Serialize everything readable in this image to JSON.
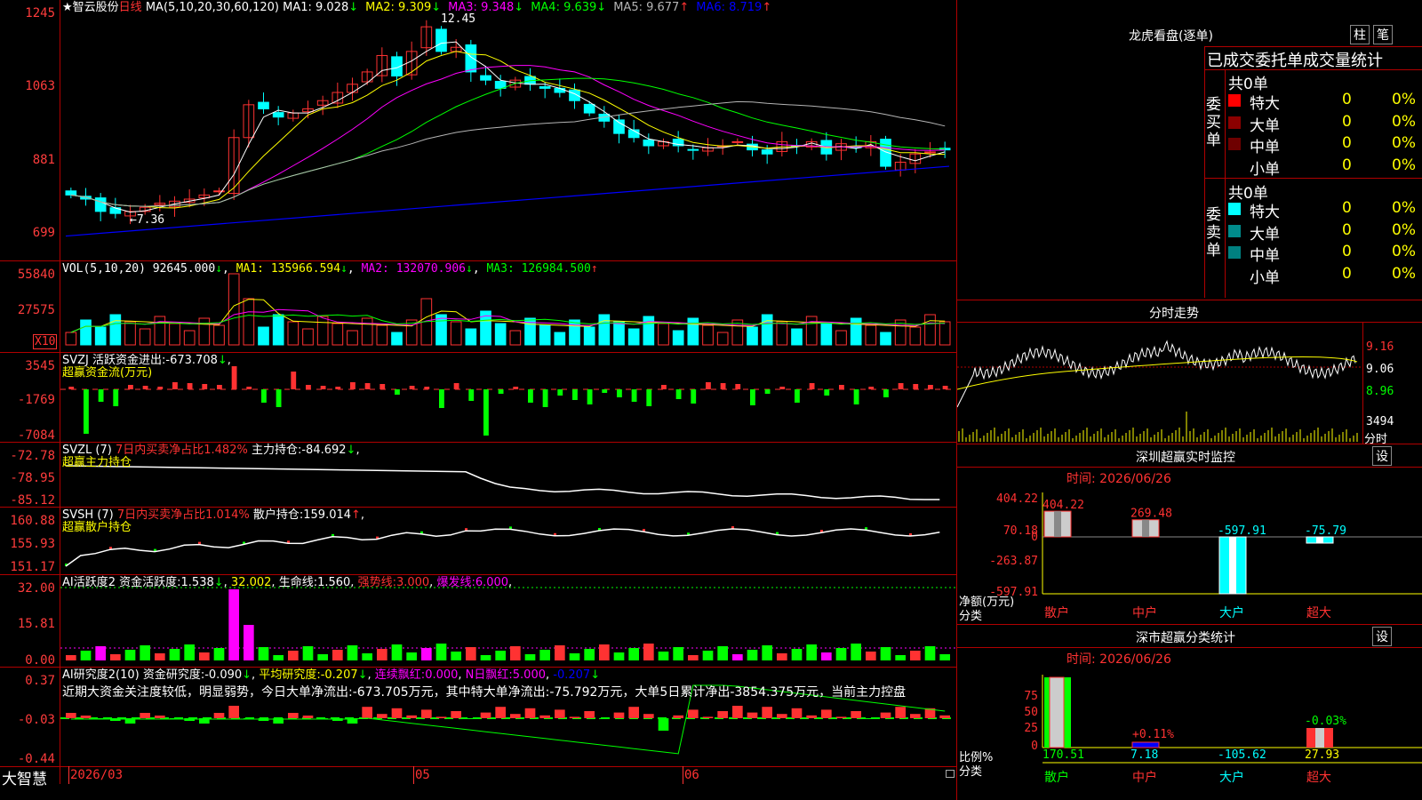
{
  "colors": {
    "up": "#ff3232",
    "down": "#00ffff",
    "frame": "#b00000",
    "green": "#00ff00",
    "magenta": "#ff00ff",
    "yellow": "#ffff00"
  },
  "price": {
    "star_icon": "★",
    "stock_name": "智云股份",
    "period": "日线",
    "ma_label": "MA(5,10,20,30,60,120)",
    "ma_values": [
      {
        "label": "MA1:",
        "value": "9.028",
        "arrow": "↓",
        "color": "#ffffff"
      },
      {
        "label": "MA2:",
        "value": "9.309",
        "arrow": "↓",
        "color": "#ffff00"
      },
      {
        "label": "MA3:",
        "value": "9.348",
        "arrow": "↓",
        "color": "#ff00ff"
      },
      {
        "label": "MA4:",
        "value": "9.639",
        "arrow": "↓",
        "color": "#00ff00"
      },
      {
        "label": "MA5:",
        "value": "9.677",
        "arrow": "↑",
        "color": "#b4b4b4"
      },
      {
        "label": "MA6:",
        "value": "8.719",
        "arrow": "↑",
        "color": "#0000ff"
      }
    ],
    "y_labels": [
      "1245",
      "1063",
      "881",
      "699"
    ],
    "high_label": "12.45",
    "low_label": "←7.36"
  },
  "vol": {
    "title": "VOL(5,10,20)",
    "value": "92645.000",
    "arrow": "↓",
    "ma1": "MA1: 135966.594",
    "ma2": "MA2: 132070.906",
    "ma3": "MA3: 126984.500",
    "y_labels": [
      "55840",
      "27575"
    ],
    "unit": "X10"
  },
  "svzj": {
    "title": "SVZJ",
    "label": "活跃资金进出:",
    "value": "-673.708",
    "arrow": "↓",
    "subtitle": "超赢资金流(万元)",
    "y_labels": [
      "3545",
      "-1769",
      "-7084"
    ]
  },
  "svzl": {
    "title": "SVZL (7)",
    "label2": "7日内买卖净占比1.482%",
    "label3": "主力持仓:",
    "value": "-84.692",
    "subtitle": "超赢主力持仓",
    "y_labels": [
      "-72.78",
      "-78.95",
      "-85.12"
    ]
  },
  "svsh": {
    "title": "SVSH (7)",
    "label2": "7日内买卖净占比1.014%",
    "label3": "散户持仓:",
    "value": "159.014",
    "subtitle": "超赢散户持仓",
    "y_labels": [
      "160.88",
      "155.93",
      "151.17"
    ]
  },
  "ai1": {
    "title": "AI活跃度2",
    "l1": "资金活跃度:",
    "v1": "1.538",
    "v2": "32.002",
    "l3": "生命线:",
    "v3": "1.560",
    "l4": "强势线:",
    "v4": "3.000",
    "l5": "爆发线:",
    "v5": "6.000",
    "y_labels": [
      "32.00",
      "15.81",
      "0.00"
    ]
  },
  "ai2": {
    "title": "AI研究度2(10)",
    "l1": "资金研究度:",
    "v1": "-0.090",
    "l2": "平均研究度:",
    "v2": "-0.207",
    "l3": "连续飘红:",
    "v3": "0.000",
    "l4": "N日飘红:",
    "v4": "5.000",
    "v5": "-0.207",
    "comment": "近期大资金关注度较低，明显弱势，今日大单净流出:-673.705万元，其中特大单净流出:-75.792万元，大单5日累计净出-3854.375万元，当前主力控盘",
    "y_labels": [
      "0.37",
      "-0.03",
      "-0.44"
    ]
  },
  "xaxis": {
    "brand": "大智慧",
    "labels": [
      "2026/03",
      "05",
      "06"
    ]
  },
  "lhb": {
    "title": "龙虎看盘(逐单)",
    "btn1": "柱",
    "btn2": "笔",
    "tabs": [
      "已成交",
      "委托单",
      "成交量统计"
    ],
    "buy": {
      "side": "委买单",
      "total": "共0单",
      "rows": [
        {
          "name": "特大",
          "count": "0",
          "pct": "0%",
          "color": "#ff0000"
        },
        {
          "name": "大单",
          "count": "0",
          "pct": "0%",
          "color": "#8b0000"
        },
        {
          "name": "中单",
          "count": "0",
          "pct": "0%",
          "color": "#6e0000"
        },
        {
          "name": "小单",
          "count": "0",
          "pct": "0%",
          "color": "#000000"
        }
      ]
    },
    "sell": {
      "side": "委卖单",
      "total": "共0单",
      "rows": [
        {
          "name": "特大",
          "count": "0",
          "pct": "0%",
          "color": "#00ffff"
        },
        {
          "name": "大单",
          "count": "0",
          "pct": "0%",
          "color": "#008b8b"
        },
        {
          "name": "中单",
          "count": "0",
          "pct": "0%",
          "color": "#008080"
        },
        {
          "name": "小单",
          "count": "0",
          "pct": "0%",
          "color": "#000000"
        }
      ]
    }
  },
  "intraday": {
    "title": "分时走势",
    "y_labels": [
      "9.16",
      "9.06",
      "8.96"
    ],
    "vol_label": "3494",
    "vol_unit": "分时"
  },
  "sz_monitor": {
    "title": "深圳超赢实时监控",
    "btn": "设",
    "time": "时间: 2026/06/26",
    "y_labels": [
      "404.22",
      "70.18",
      "0",
      "-263.87",
      "-597.91"
    ],
    "ylabel": "净额(万元)",
    "xlabel": "分类",
    "categories": [
      "散户",
      "中户",
      "大户",
      "超大"
    ],
    "values": [
      404.22,
      269.48,
      -597.91,
      -75.79
    ],
    "value_labels": [
      "404.22",
      "269.48",
      "-597.91",
      "-75.79"
    ]
  },
  "sz_class": {
    "title": "深市超赢分类统计",
    "btn": "设",
    "time": "时间: 2026/06/26",
    "y_labels": [
      "75",
      "50",
      "25",
      "0"
    ],
    "ylabel": "比例%",
    "xlabel": "分类",
    "categories": [
      "散户",
      "中户",
      "大户",
      "超大"
    ],
    "bar_labels": [
      "+0.11%",
      "-0.03%"
    ],
    "bottom_values": [
      "170.51",
      "7.18",
      "-105.62",
      "27.93"
    ]
  },
  "chart_data": [
    {
      "type": "candlestick",
      "title": "智云股份 日线",
      "ylim": [
        6.99,
        12.45
      ],
      "note": "close prices approx",
      "close": [
        8.0,
        7.9,
        7.6,
        7.55,
        7.6,
        7.7,
        7.8,
        7.85,
        7.9,
        8.0,
        8.1,
        9.4,
        10.2,
        10.1,
        9.9,
        10.0,
        10.1,
        10.3,
        10.5,
        10.7,
        11.0,
        11.4,
        10.9,
        11.5,
        12.1,
        11.5,
        11.6,
        11.0,
        10.8,
        10.6,
        10.8,
        10.7,
        10.6,
        10.5,
        10.3,
        10.0,
        9.8,
        9.5,
        9.4,
        9.2,
        9.3,
        9.2,
        9.1,
        9.15,
        9.2,
        9.3,
        9.1,
        9.0,
        9.3,
        9.2,
        9.3,
        9.0,
        9.25,
        9.15,
        9.3,
        8.7,
        8.8,
        9.0,
        9.05,
        9.1
      ]
    },
    {
      "type": "bar",
      "title": "VOL(5,10,20)",
      "ylim": [
        0,
        55840
      ],
      "values": [
        92645
      ]
    },
    {
      "type": "bar",
      "title": "深圳超赢实时监控",
      "categories": [
        "散户",
        "中户",
        "大户",
        "超大"
      ],
      "values": [
        404.22,
        269.48,
        -597.91,
        -75.79
      ],
      "ylabel": "净额(万元)",
      "xlabel": "分类",
      "ylim": [
        -597.91,
        404.22
      ]
    },
    {
      "type": "bar",
      "title": "深市超赢分类统计",
      "categories": [
        "散户",
        "中户",
        "大户",
        "超大"
      ],
      "values": [
        170.51,
        7.18,
        -105.62,
        27.93
      ],
      "ylabel": "比例%",
      "xlabel": "分类",
      "ylim": [
        0,
        75
      ]
    }
  ]
}
